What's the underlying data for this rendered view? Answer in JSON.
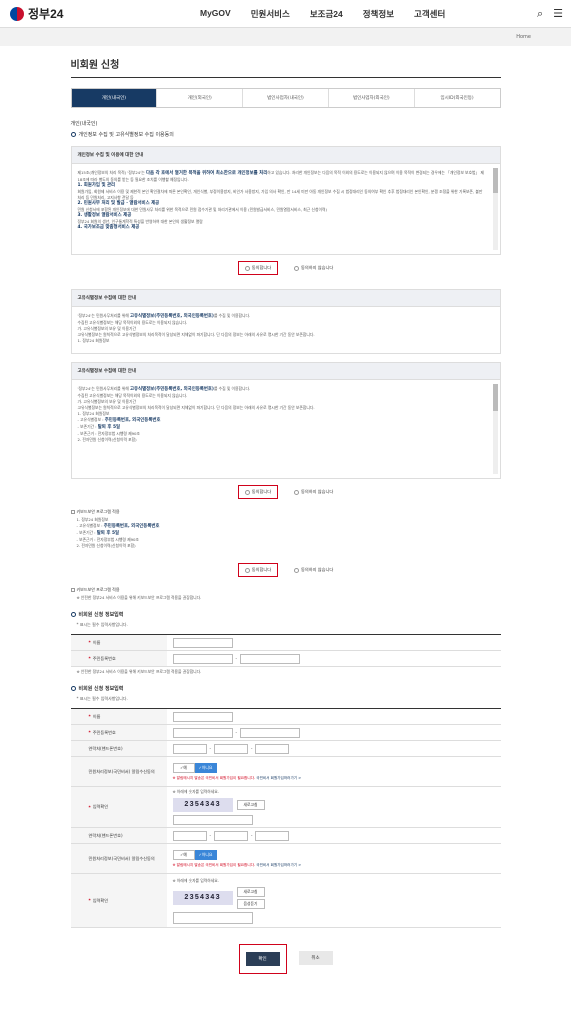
{
  "header": {
    "logo_text": "정부24",
    "nav": [
      "MyGOV",
      "민원서비스",
      "보조금24",
      "정책정보",
      "고객센터"
    ],
    "icons": [
      "search-icon",
      "menu-icon"
    ]
  },
  "breadcrumb": "Home",
  "page_title": "비회원 신청",
  "tabs": [
    "개인(내국인)",
    "개인(외국인)",
    "법인사업자(내국인)",
    "법인사업자(외국인)",
    "임시ID(외국인등)"
  ],
  "section_label": "개인(내국인)",
  "consent_heading": "개인정보 수집 및 고유식별정보 수집 이용동의",
  "panel1": {
    "title": "개인정보 수집 및 이용에 대한 안내",
    "body1": "제15조(개인정보의 처리 목적) '정부24'는",
    "highlight1": "다음 각 호에서 열거한 목적을 위하여 최소한으로 개인정보를 처리",
    "body2": "하고 있습니다. 처리한 개인정보는 다음의 목적 이외의 용도로는 이용되지 않으며 이용 목적이 변경되는 경우에는 「개인정보 보호법」 제18조에 따라 별도의 동의를 받는 등 필요한 조치를 이행할 예정입니다.",
    "item1": "1. 회원가입 및 관리",
    "item1_text": "회원가입, 회원제 서비스 이용 및 제한적 본인 확인절차에 따른 본인확인, 개인식별, 부정이용방지, 비인가 사용방지, 가입 의사 확인, 만 14세 미만 아동 개인정보 수집 시 법정대리인 동의여부 확인 추후 법정대리인 본인확인, 분쟁 조정을 위한 기록보존, 불만처리 등 민원처리, 고지사항 전달 등",
    "item2": "2. 민원사무 처리 및 발급 · 열람서비스 제공",
    "item2_text": "민원 신청서에 포함된 개인정보에 대한 민원사무 처리를 위한 목적으로 민원 접수기관 및 처리기관에서 이용 (민원발급서비스, 민원열람서비스, 최근 신청이력)",
    "item3": "3. 생활정보 열람서비스 제공",
    "item3_text": "정부24 회원의 생년, 인구통계학적 특성을 반영하여 대한 본인의 생활정보 열람",
    "item4": "4. 국가보조금 맞춤형서비스 제공",
    "agree": "동의합니다",
    "disagree": "동의하지 않습니다"
  },
  "panel2": {
    "title": "고유식별정보 수집에 대한 안내",
    "body1": "'정부24'는 민원사무처리를 위해",
    "highlight": "고유식별정보(주민등록번호, 외국인등록번호)",
    "body2": "를 수집 및 이용합니다.",
    "body3": "수집된 고유식별정보는 해당 목적이외의 용도로는 이용되지 않습니다.",
    "body4": "가. 고유식별정보의 보유 및 이용기간",
    "body5": "고유식별정보는 원칙적으로 고유식별정보의 처리목적이 달성되면 지체없이 파기합니다. 단 다음의 정보는 아래의 사유로 명시한 기간 동안 보존합니다.",
    "body6": "1. 정부24 회원정보"
  },
  "panel3": {
    "title": "고유식별정보 수집에 대한 안내",
    "body1": "'정부24'는 민원사무처리를 위해",
    "highlight": "고유식별정보(주민등록번호, 외국인등록번호)",
    "body2": "를 수집 및 이용합니다.",
    "body3": "수집된 고유식별정보는 해당 목적이외의 용도로는 이용되지 않습니다.",
    "body4": "가. 고유식별정보의 보유 및 이용기간",
    "body5": "고유식별정보는 원칙적으로 고유식별정보의 처리목적이 달성되면 지체없이 파기합니다. 단 다음의 정보는 아래의 사유로 명시한 기간 동안 보존합니다.",
    "body6": "1. 정부24 회원정보",
    "body7": "- 고유식별정보 :",
    "body7_hl": "주민등록번호, 외국인등록번호",
    "body8": "- 보존기간 :",
    "body8_hl": "탈퇴 후 5일",
    "body9": "- 보존근거 : 전자정부법 시행령 제90조",
    "body10": "2. 전자민원 신청이력(신청이력 포함)",
    "agree": "동의합니다",
    "disagree": "동의하지 않습니다"
  },
  "keyboard_check": "키보드보안 프로그램 적용",
  "keyboard_note": "※ 안전한 정부24 서비스 이용을 위해 키보드보안 프로그램 적용을 권장합니다.",
  "panel4": {
    "body1": "1. 정부24 회원정보",
    "body2": "- 고유식별정보 :",
    "body2_hl": "주민등록번호, 외국인등록번호",
    "body3": "- 보존기간 :",
    "body3_hl": "탈퇴 후 5일",
    "body4": "- 보존근거 : 전자정부법 시행령 제90조",
    "body5": "2. 전자민원 신청이력(신청이력 포함)",
    "agree": "동의합니다",
    "disagree": "동의하지 않습니다"
  },
  "form1": {
    "title": "비회원 신청 정보입력",
    "required_note": "* 표시는 필수 입력사항입니다.",
    "name_label": "이름",
    "rrn_label": "주민등록번호",
    "note": "※ 안전한 정부24 서비스 이용을 위해 키보드보안 프로그램 적용을 권장합니다."
  },
  "form2": {
    "title": "비회원 신청 정보입력",
    "required_note": "* 표시는 필수 입력사항입니다.",
    "name_label": "이름",
    "rrn_label": "주민등록번호",
    "phone_label": "연락처(핸드폰번호)",
    "sms_label": "민원처리정보(국민비서) 알림수신동의",
    "yes": "예",
    "no": "아니요",
    "warn": "※ 알림메시지 발송은 국민비서 회원가입이 필요합니다.",
    "warn_link": "국민비서 회원가입하러가기 >",
    "captcha_note": "※ 아래에 숫자를 입력하세요.",
    "captcha_label": "입력확인",
    "captcha_text": "2354343",
    "refresh": "새로고침",
    "audio": "음성듣기",
    "phone2_label": "연락처(핸드폰번호)",
    "sms2_label": "민원처리정보(국민비서) 알림수신동의"
  },
  "buttons": {
    "confirm": "확인",
    "cancel": "취소"
  }
}
